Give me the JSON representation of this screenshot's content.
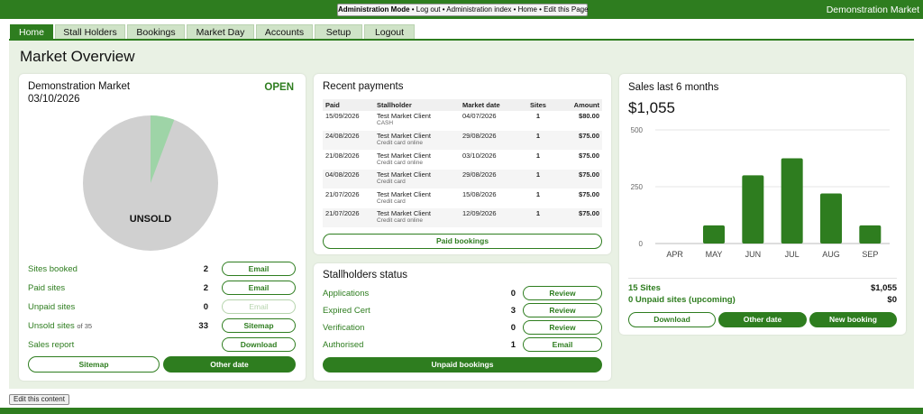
{
  "topbar": {
    "admin_mode": "Administration Mode",
    "links": " • Log out • Administration index • Home • Edit this Page",
    "brand": "Demonstration Market"
  },
  "nav": {
    "tabs": [
      "Home",
      "Stall Holders",
      "Bookings",
      "Market Day",
      "Accounts",
      "Setup",
      "Logout"
    ]
  },
  "page": {
    "title": "Market Overview"
  },
  "market": {
    "name": "Demonstration Market",
    "date": "03/10/2026",
    "status": "OPEN",
    "pie_label": "UNSOLD",
    "sold_fraction": 0.057,
    "rows": [
      {
        "label": "Sites booked",
        "note": "",
        "value": "2",
        "button": "Email"
      },
      {
        "label": "Paid sites",
        "note": "",
        "value": "2",
        "button": "Email"
      },
      {
        "label": "Unpaid sites",
        "note": "",
        "value": "0",
        "button": "Email"
      },
      {
        "label": "Unsold sites",
        "note": "of 35",
        "value": "33",
        "button": "Sitemap"
      },
      {
        "label": "Sales report",
        "note": "",
        "value": "",
        "button": "Download"
      }
    ],
    "footer_buttons": [
      "Sitemap",
      "Other date"
    ]
  },
  "payments": {
    "title": "Recent payments",
    "headers": [
      "Paid",
      "Stallholder",
      "Market date",
      "Sites",
      "Amount"
    ],
    "rows": [
      {
        "paid": "15/09/2026",
        "holder": "Test Market Client",
        "method": "CASH",
        "market_date": "04/07/2026",
        "sites": "1",
        "amount": "$80.00"
      },
      {
        "paid": "24/08/2026",
        "holder": "Test Market Client",
        "method": "Credit card online",
        "market_date": "29/08/2026",
        "sites": "1",
        "amount": "$75.00"
      },
      {
        "paid": "21/08/2026",
        "holder": "Test Market Client",
        "method": "Credit card online",
        "market_date": "03/10/2026",
        "sites": "1",
        "amount": "$75.00"
      },
      {
        "paid": "04/08/2026",
        "holder": "Test Market Client",
        "method": "Credit card",
        "market_date": "29/08/2026",
        "sites": "1",
        "amount": "$75.00"
      },
      {
        "paid": "21/07/2026",
        "holder": "Test Market Client",
        "method": "Credit card",
        "market_date": "15/08/2026",
        "sites": "1",
        "amount": "$75.00"
      },
      {
        "paid": "21/07/2026",
        "holder": "Test Market Client",
        "method": "Credit card online",
        "market_date": "12/09/2026",
        "sites": "1",
        "amount": "$75.00"
      }
    ],
    "button": "Paid bookings"
  },
  "stallholders": {
    "title": "Stallholders status",
    "rows": [
      {
        "label": "Applications",
        "value": "0",
        "button": "Review"
      },
      {
        "label": "Expired Cert",
        "value": "3",
        "button": "Review"
      },
      {
        "label": "Verification",
        "value": "0",
        "button": "Review"
      },
      {
        "label": "Authorised",
        "value": "1",
        "button": "Email"
      }
    ],
    "button": "Unpaid bookings"
  },
  "sales": {
    "title": "Sales last 6 months",
    "total": "$1,055",
    "sites_label": "15 Sites",
    "sites_value": "$1,055",
    "unpaid_label": "0 Unpaid sites (upcoming)",
    "unpaid_value": "$0",
    "buttons": [
      "Download",
      "Other date",
      "New booking"
    ]
  },
  "chart_data": {
    "type": "bar",
    "categories": [
      "APR",
      "MAY",
      "JUN",
      "JUL",
      "AUG",
      "SEP"
    ],
    "values": [
      0,
      80,
      300,
      375,
      220,
      80
    ],
    "title": "",
    "ylim": [
      0,
      500
    ],
    "yticks": [
      "0",
      "250",
      "500"
    ],
    "bar_color": "#2e7d1f",
    "grid": true
  },
  "edit": {
    "label": "Edit this content"
  },
  "colors": {
    "brand_green": "#2e7d1f",
    "pie_unsold": "#d0d0d0",
    "pie_sold": "#9ed4a7"
  }
}
